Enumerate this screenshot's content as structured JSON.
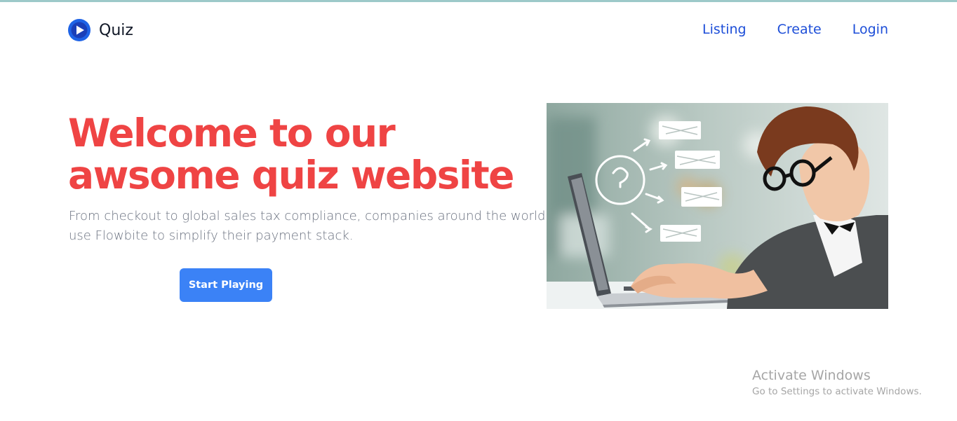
{
  "brand": {
    "name": "Quiz",
    "icon": "play-circle-icon",
    "color": "#1d4ed8"
  },
  "nav": {
    "items": [
      {
        "label": "Listing"
      },
      {
        "label": "Create"
      },
      {
        "label": "Login"
      }
    ]
  },
  "hero": {
    "title_line1": "Welcome to our",
    "title_line2": "awsome quiz website",
    "description": "From checkout to global sales tax compliance, companies around the world use Flowbite to simplify their payment stack.",
    "cta_label": "Start Playing",
    "image": "man-at-laptop-with-question-mark-illustration"
  },
  "watermark": {
    "title": "Activate Windows",
    "subtitle": "Go to Settings to activate Windows."
  },
  "colors": {
    "title": "#ef4444",
    "nav_link": "#1d4ed8",
    "button": "#3b82f6",
    "description": "#6b7280"
  }
}
